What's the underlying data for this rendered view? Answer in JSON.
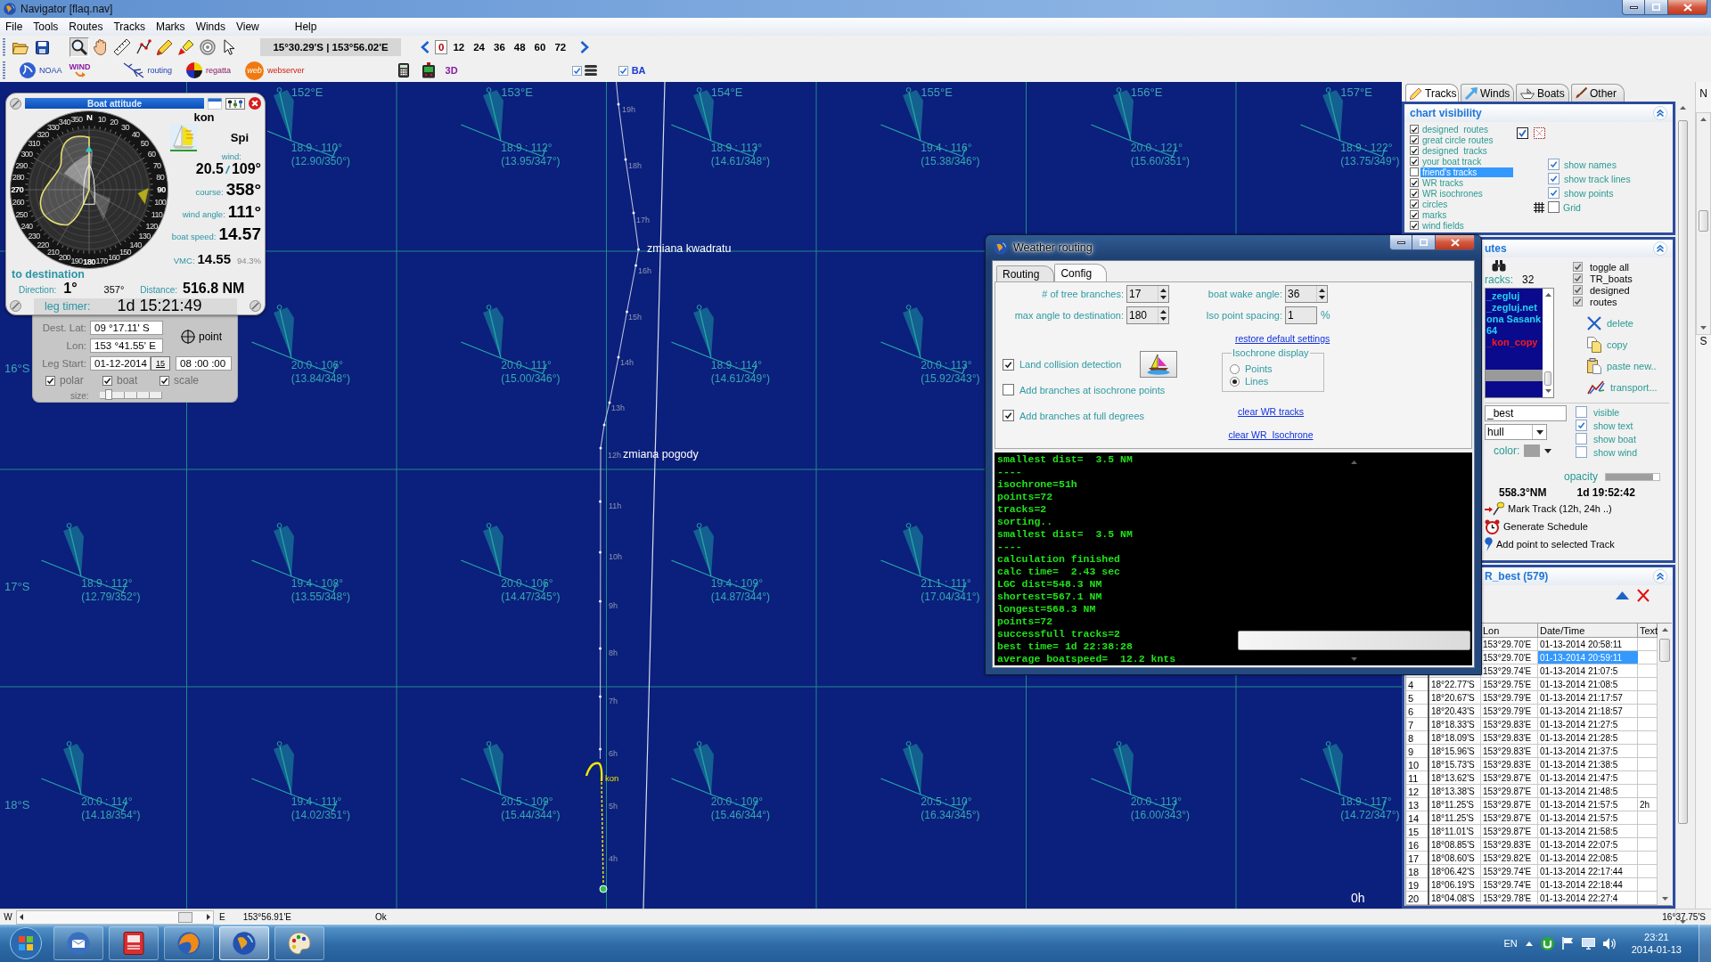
{
  "window": {
    "title": "Navigator [flaq.nav]"
  },
  "menu": [
    "File",
    "Tools",
    "Routes",
    "Tracks",
    "Marks",
    "Winds",
    "View",
    "Help"
  ],
  "toolbar": {
    "tools": [
      {
        "kind": "zoom",
        "selected": true
      },
      {
        "kind": "pan",
        "selected": false
      },
      {
        "kind": "measure",
        "selected": false
      },
      {
        "kind": "route",
        "selected": false
      },
      {
        "kind": "pencil",
        "selected": false
      },
      {
        "kind": "marker",
        "selected": false
      },
      {
        "kind": "target",
        "selected": false
      },
      {
        "kind": "pointer",
        "selected": false
      }
    ],
    "coordinates": "15°30.29'S | 153°56.02'E",
    "hours": [
      {
        "label": "0",
        "selected": true
      },
      {
        "label": "12",
        "selected": false
      },
      {
        "label": "24",
        "selected": false
      },
      {
        "label": "36",
        "selected": false
      },
      {
        "label": "48",
        "selected": false
      },
      {
        "label": "60",
        "selected": false
      },
      {
        "label": "72",
        "selected": false
      }
    ]
  },
  "toolbar2": {
    "apps": [
      {
        "kind": "noaa",
        "label": "NOAA"
      },
      {
        "kind": "wind",
        "label": "WIND"
      },
      {
        "kind": "routing",
        "label": "routing"
      },
      {
        "kind": "regatta",
        "label": "regatta"
      },
      {
        "kind": "webserver",
        "label": "webserver",
        "badge": "web"
      }
    ],
    "view_3d": "3D",
    "layers_toggle": {
      "checked": true
    },
    "ba_toggle": {
      "label": "BA",
      "checked": true
    }
  },
  "map": {
    "longitudes": [
      "152°E",
      "153°E",
      "154°E",
      "155°E",
      "156°E",
      "157°E"
    ],
    "latitudes": [
      "16°S",
      "17°S",
      "18°S"
    ],
    "wind_rows": [
      [
        null,
        {
          "speed_dir": "18.9 : 110°",
          "detail": "(12.90/350°)"
        },
        {
          "speed_dir": "18.9 : 112°",
          "detail": "(13.95/347°)"
        },
        {
          "speed_dir": "18.9 : 113°",
          "detail": "(14.61/348°)"
        },
        {
          "speed_dir": "19.4 : 116°",
          "detail": "(15.38/346°)"
        },
        {
          "speed_dir": "20.0 : 121°",
          "detail": "(15.60/351°)"
        },
        {
          "speed_dir": "18.9 : 122°",
          "detail": "(13.75/349°)"
        }
      ],
      [
        null,
        {
          "speed_dir": "20.0 : 106°",
          "detail": "(13.84/348°)"
        },
        {
          "speed_dir": "20.0 : 111°",
          "detail": "(15.00/346°)"
        },
        {
          "speed_dir": "18.9 : 114°",
          "detail": "(14.61/349°)"
        },
        {
          "speed_dir": "20.0 : 113°",
          "detail": "(15.92/343°)"
        },
        null,
        null
      ],
      [
        {
          "speed_dir": "18.9 : 112°",
          "detail": "(12.79/352°)"
        },
        {
          "speed_dir": "19.4 : 108°",
          "detail": "(13.55/348°)"
        },
        {
          "speed_dir": "20.0 : 106°",
          "detail": "(14.47/345°)"
        },
        {
          "speed_dir": "19.4 : 109°",
          "detail": "(14.87/344°)"
        },
        {
          "speed_dir": "21.1 : 111°",
          "detail": "(17.04/341°)"
        },
        null,
        null
      ],
      [
        {
          "speed_dir": "20.0 : 114°",
          "detail": "(14.18/354°)"
        },
        {
          "speed_dir": "19.4 : 111°",
          "detail": "(14.02/351°)"
        },
        {
          "speed_dir": "20.5 : 109°",
          "detail": "(15.44/344°)"
        },
        {
          "speed_dir": "20.0 : 109°",
          "detail": "(15.46/344°)"
        },
        {
          "speed_dir": "20.5 : 110°",
          "detail": "(16.34/345°)"
        },
        {
          "speed_dir": "20.0 : 113°",
          "detail": "(16.00/343°)"
        },
        {
          "speed_dir": "18.9 : 117°",
          "detail": "(14.72/347°)"
        }
      ]
    ],
    "track": {
      "hours": [
        "19h",
        "18h",
        "17h",
        "16h",
        "15h",
        "14h",
        "13h",
        "12h",
        "11h",
        "10h",
        "9h",
        "8h",
        "7h",
        "6h",
        "5h",
        "4h"
      ],
      "notes": [
        "zmiana kwadratu",
        "zmiana pogody"
      ],
      "boat": "kon"
    },
    "time": "0h"
  },
  "boat_attitude": {
    "title": "Boat attitude",
    "dial_labels": [
      [
        "N"
      ],
      [
        "350",
        "10"
      ],
      [
        "340",
        "20"
      ],
      [
        "330",
        "30"
      ],
      [
        "320",
        "40"
      ],
      [
        "310",
        "50"
      ],
      [
        "300",
        "60"
      ],
      [
        "290",
        "70"
      ],
      [
        "280",
        "80"
      ],
      [
        "270",
        "90"
      ],
      [
        "260",
        "100"
      ],
      [
        "250",
        "110"
      ],
      [
        "240",
        "120"
      ],
      [
        "230",
        "130"
      ],
      [
        "220",
        "140"
      ],
      [
        "210",
        "150"
      ],
      [
        "200",
        "160"
      ],
      [
        "190",
        "170"
      ],
      [
        "180"
      ]
    ],
    "boat": "kon",
    "sail": "Spi",
    "readings": [
      {
        "kind": "wind",
        "label": "wind:",
        "speed": "20.5",
        "direction": "109°"
      },
      {
        "kind": "course",
        "label": "course:",
        "value": "358°"
      },
      {
        "kind": "angle",
        "label": "wind angle:",
        "value": "111°"
      },
      {
        "kind": "speed",
        "label": "boat speed:",
        "value": "14.57"
      },
      {
        "kind": "vmc",
        "label": "VMC:",
        "value": "14.55",
        "share": "94.3%"
      }
    ],
    "destination": {
      "title": "to destination",
      "direction_label": "Direction:",
      "direction": "1°",
      "bearing": "357°",
      "distance_label": "Distance:",
      "distance": "516.8 NM"
    },
    "timer_label": "leg timer:",
    "timer": "1d 15:21:49"
  },
  "leg_settings": {
    "dest_lat_label": "Dest. Lat:",
    "dest_lat": "09 °17.11' S",
    "lon_label": "Lon:",
    "lon": "153 °41.55' E",
    "point_label": "point",
    "start_label": "Leg Start:",
    "start_date": "01-12-2014",
    "calendar_day": "15",
    "start_time": "08 :00 :00",
    "options": [
      {
        "label": "polar",
        "checked": true
      },
      {
        "label": "boat",
        "checked": true
      },
      {
        "label": "scale",
        "checked": true
      }
    ],
    "size_label": "size:",
    "size": {
      "level": 0.15
    }
  },
  "weather_routing": {
    "title": "Weather routing",
    "tabs": [
      {
        "label": "Routing",
        "selected": false
      },
      {
        "label": "Config",
        "selected": true
      }
    ],
    "fields": [
      {
        "kind": "spin",
        "label": "# of tree branches:",
        "value": "17"
      },
      {
        "kind": "spin",
        "label": "boat wake angle:",
        "value": "36"
      },
      {
        "kind": "spin",
        "label": "max angle to destination:",
        "value": "180"
      },
      {
        "kind": "plain",
        "label": "Iso point spacing:",
        "value": "1",
        "unit": "%"
      }
    ],
    "restore_link": "restore default settings",
    "options": [
      {
        "label": "Land collision detection",
        "checked": true
      },
      {
        "label": "Add branches at isochrone points",
        "checked": false
      },
      {
        "label": "Add branches at full degrees",
        "checked": true
      }
    ],
    "isochrone_display": {
      "title": "Isochrone display",
      "choices": [
        {
          "label": "Points",
          "selected": false
        },
        {
          "label": "Lines",
          "selected": true
        }
      ]
    },
    "links": [
      "clear WR tracks",
      "clear WR  Isochrone"
    ],
    "log": [
      "smallest dist=  3.5 NM",
      "----",
      "isochrone=51h",
      "points=72",
      "tracks=2",
      "sorting..",
      "smallest dist=  3.5 NM",
      "----",
      "calculation finished",
      "calc time=  2.43 sec",
      "LGC dist=548.3 NM",
      "shortest=567.1 NM",
      "longest=568.3 NM",
      "points=72",
      "successfull tracks=2",
      "best time= 1d 22:38:28",
      "average boatspeed=  12.2 knts"
    ]
  },
  "side_panel": {
    "tabs": [
      {
        "kind": "tracks",
        "label": "Tracks",
        "selected": true
      },
      {
        "kind": "winds",
        "label": "Winds",
        "selected": false
      },
      {
        "kind": "boats",
        "label": "Boats",
        "selected": false
      },
      {
        "kind": "other",
        "label": "Other",
        "selected": false
      }
    ],
    "chart_visibility": {
      "title": "chart visibility",
      "layers": [
        {
          "label": "designed  routes",
          "checked": true,
          "selected": false
        },
        {
          "label": "great circle routes",
          "checked": true,
          "selected": false
        },
        {
          "label": "designed  tracks",
          "checked": true,
          "selected": false
        },
        {
          "label": "your boat track",
          "checked": true,
          "selected": false
        },
        {
          "label": "friend's tracks",
          "checked": false,
          "selected": true
        },
        {
          "label": "WR tracks",
          "checked": true,
          "selected": false
        },
        {
          "label": "WR isochrones",
          "checked": true,
          "selected": false
        },
        {
          "label": "circles",
          "checked": true,
          "selected": false
        },
        {
          "label": "marks",
          "checked": true,
          "selected": false
        },
        {
          "label": "wind fields",
          "checked": true,
          "selected": false
        }
      ],
      "display": [
        {
          "label": "show names",
          "checked": true
        },
        {
          "label": "show track lines",
          "checked": true
        },
        {
          "label": "show points",
          "checked": true
        }
      ],
      "grid": {
        "label": "Grid",
        "checked": false
      }
    },
    "routes": {
      "title": "utes",
      "count_label": "racks:",
      "count": "32",
      "tracks": [
        {
          "label": "_zegluj",
          "color": "#22d3f0",
          "selected": false
        },
        {
          "label": "_zegluj.net",
          "color": "#22d3f0",
          "selected": false
        },
        {
          "label": "ona Sasank",
          "color": "#22d3f0",
          "selected": false
        },
        {
          "label": "64",
          "color": "#22d3f0",
          "selected": false
        },
        {
          "label": "_kon_copy",
          "color": "#ff1a1a",
          "selected": false
        },
        {
          "selected": true
        }
      ],
      "filters": [
        {
          "label": "toggle all",
          "checked": true
        },
        {
          "label": "TR_boats",
          "checked": true
        },
        {
          "label": "designed",
          "checked": true
        },
        {
          "label": "routes",
          "checked": true
        }
      ],
      "actions": [
        {
          "kind": "delete",
          "label": "delete"
        },
        {
          "kind": "copy",
          "label": "copy"
        },
        {
          "kind": "paste",
          "label": "paste new.."
        },
        {
          "kind": "transport",
          "label": "transport..."
        }
      ],
      "track_name": "_best",
      "hull": "hull",
      "color_label": "color:",
      "track_options": [
        {
          "label": "visible",
          "checked": false
        },
        {
          "label": "show text",
          "checked": true
        },
        {
          "label": "show boat",
          "checked": false
        },
        {
          "label": "show wind",
          "checked": false
        }
      ],
      "opacity_label": "opacity",
      "opacity": {
        "level": 0.88
      },
      "distance": "558.3°NM",
      "duration": "1d 19:52:42",
      "commands": [
        {
          "kind": "mark",
          "label": "Mark Track (12h, 24h ..)"
        },
        {
          "kind": "schedule",
          "label": "Generate Schedule"
        },
        {
          "kind": "add_point",
          "label": "Add point to selected Track"
        }
      ]
    }
  },
  "track_points": {
    "title": "R_best (579)",
    "columns": [
      "Lon",
      "Date/Time",
      "Text"
    ],
    "rows": [
      {
        "lon": "153°29.70'E",
        "time": "01-13-2014 20:58:11",
        "selected": false
      },
      {
        "lon": "153°29.70'E",
        "time": "01-13-2014 20:59:11",
        "selected": true
      },
      {
        "lon": "153°29.74'E",
        "time": "01-13-2014 21:07:5",
        "selected": false
      },
      {
        "index": "4",
        "lat": "18°22.77'S",
        "lon": "153°29.75'E",
        "time": "01-13-2014 21:08:5",
        "selected": false
      },
      {
        "index": "5",
        "lat": "18°20.67'S",
        "lon": "153°29.79'E",
        "time": "01-13-2014 21:17:57",
        "selected": false
      },
      {
        "index": "6",
        "lat": "18°20.43'S",
        "lon": "153°29.79'E",
        "time": "01-13-2014 21:18:57",
        "selected": false
      },
      {
        "index": "7",
        "lat": "18°18.33'S",
        "lon": "153°29.83'E",
        "time": "01-13-2014 21:27:5",
        "selected": false
      },
      {
        "index": "8",
        "lat": "18°18.09'S",
        "lon": "153°29.83'E",
        "time": "01-13-2014 21:28:5",
        "selected": false
      },
      {
        "index": "9",
        "lat": "18°15.96'S",
        "lon": "153°29.83'E",
        "time": "01-13-2014 21:37:5",
        "selected": false
      },
      {
        "index": "10",
        "lat": "18°15.73'S",
        "lon": "153°29.83'E",
        "time": "01-13-2014 21:38:5",
        "selected": false
      },
      {
        "index": "11",
        "lat": "18°13.62'S",
        "lon": "153°29.87'E",
        "time": "01-13-2014 21:47:5",
        "selected": false
      },
      {
        "index": "12",
        "lat": "18°13.38'S",
        "lon": "153°29.87'E",
        "time": "01-13-2014 21:48:5",
        "selected": false
      },
      {
        "index": "13",
        "lat": "18°11.25'S",
        "lon": "153°29.87'E",
        "time": "01-13-2014 21:57:5",
        "text": "2h",
        "selected": false
      },
      {
        "index": "14",
        "lat": "18°11.25'S",
        "lon": "153°29.87'E",
        "time": "01-13-2014 21:57:5",
        "selected": false
      },
      {
        "index": "15",
        "lat": "18°11.01'S",
        "lon": "153°29.87'E",
        "time": "01-13-2014 21:58:5",
        "selected": false
      },
      {
        "index": "16",
        "lat": "18°08.85'S",
        "lon": "153°29.83'E",
        "time": "01-13-2014 22:07:5",
        "selected": false
      },
      {
        "index": "17",
        "lat": "18°08.60'S",
        "lon": "153°29.82'E",
        "time": "01-13-2014 22:08:5",
        "selected": false
      },
      {
        "index": "18",
        "lat": "18°06.42'S",
        "lon": "153°29.74'E",
        "time": "01-13-2014 22:17:44",
        "selected": false
      },
      {
        "index": "19",
        "lat": "18°06.19'S",
        "lon": "153°29.74'E",
        "time": "01-13-2014 22:18:44",
        "selected": false
      },
      {
        "index": "20",
        "lat": "18°04.08'S",
        "lon": "153°29.78'E",
        "time": "01-13-2014 22:27:4",
        "selected": false
      }
    ]
  },
  "scale_strip": {
    "north": "N",
    "south": "S"
  },
  "status_bar": {
    "west": "W",
    "east": "E",
    "cursor_lon": "153°56.91'E",
    "state": "Ok",
    "cursor_lat": "16°37.75'S"
  },
  "taskbar": {
    "apps": [
      {
        "kind": "mail",
        "selected": false
      },
      {
        "kind": "notebook",
        "selected": false
      },
      {
        "kind": "browser",
        "selected": false
      },
      {
        "kind": "navigator",
        "selected": true
      },
      {
        "kind": "paint",
        "selected": false
      }
    ],
    "language": "EN",
    "time": "23:21",
    "date": "2014-01-13"
  }
}
